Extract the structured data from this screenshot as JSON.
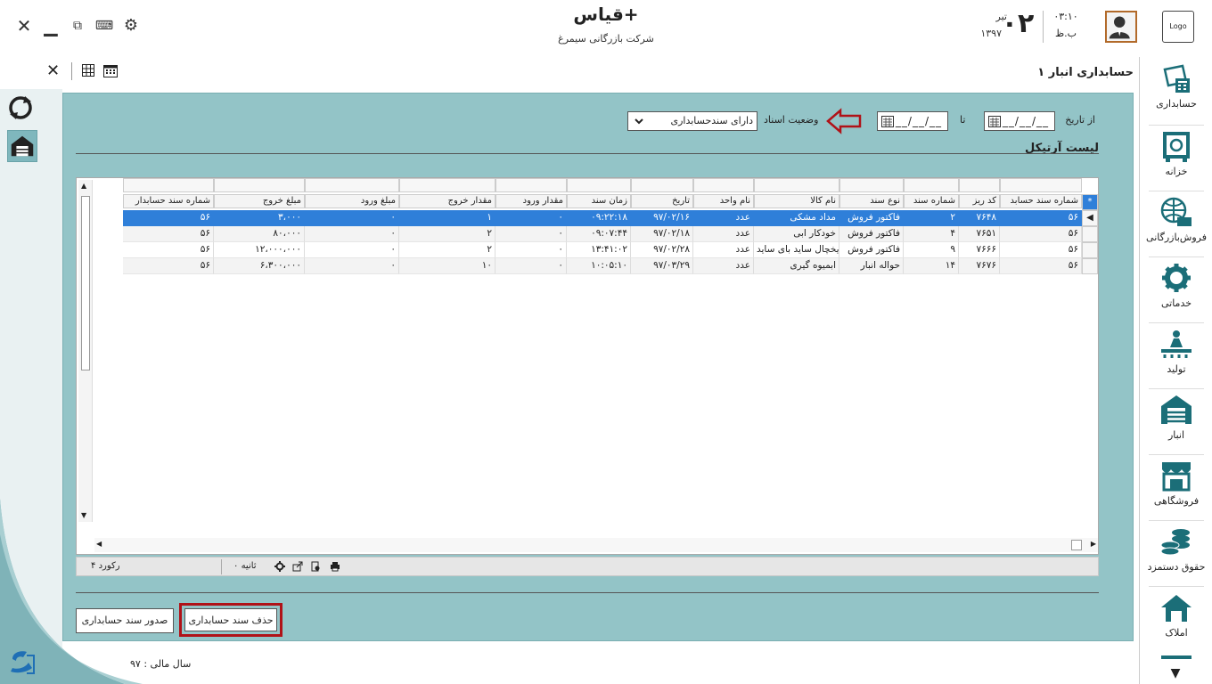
{
  "header": {
    "app_title": "قیاس+",
    "company": "شرکت بازرگانی سیمرغ",
    "time": "۰۳:۱۰",
    "ampm": "ب.ظ",
    "day": "۰۲",
    "month": "تیر",
    "year": "۱۳۹۷",
    "logo_text": "Logo"
  },
  "tab": {
    "page_title": "حسابداری انبار ۱"
  },
  "filters": {
    "from_date_label": "از تاریخ",
    "from_date_value": "__/__/__",
    "to_label": "تا",
    "to_date_value": "__/__/__",
    "status_label": "وضعیت اسناد",
    "status_value": "دارای سندحسابداری"
  },
  "list": {
    "title": "لیست آرتیکل",
    "columns": [
      "شماره سند حسابد",
      "کد ریز",
      "شماره سند",
      "نوع سند",
      "نام کالا",
      "نام واحد",
      "تاریخ",
      "زمان سند",
      "مقدار ورود",
      "مقدار خروج",
      "مبلغ ورود",
      "مبلغ خروج",
      "شماره سند حسابدار"
    ],
    "rows": [
      [
        "۵۶",
        "۷۶۴۸",
        "۲",
        "فاکتور فروش",
        "مداد مشکی",
        "عدد",
        "۹۷/۰۲/۱۶",
        "۰۹:۲۲:۱۸",
        "۰",
        "۱",
        "۰",
        "۳،۰۰۰",
        "۵۶"
      ],
      [
        "۵۶",
        "۷۶۵۱",
        "۴",
        "فاکتور فروش",
        "خودکار ابی",
        "عدد",
        "۹۷/۰۲/۱۸",
        "۰۹:۰۷:۴۴",
        "۰",
        "۲",
        "۰",
        "۸۰،۰۰۰",
        "۵۶"
      ],
      [
        "۵۶",
        "۷۶۶۶",
        "۹",
        "فاکتور فروش",
        "یخچال ساید بای ساید",
        "عدد",
        "۹۷/۰۲/۲۸",
        "۱۳:۴۱:۰۲",
        "۰",
        "۲",
        "۰",
        "۱۲،۰۰۰،۰۰۰",
        "۵۶"
      ],
      [
        "۵۶",
        "۷۶۷۶",
        "۱۴",
        "حواله انبار",
        "ابمیوه گیری",
        "عدد",
        "۹۷/۰۳/۲۹",
        "۱۰:۰۵:۱۰",
        "۰",
        "۱۰",
        "۰",
        "۶،۳۰۰،۰۰۰",
        "۵۶"
      ]
    ],
    "selected_row": 0
  },
  "footer": {
    "records": "۴ رکورد",
    "seconds": "۰ ثانیه"
  },
  "buttons": {
    "delete_doc": "حذف سند حسابداری",
    "issue_doc": "صدور سند حسابداری"
  },
  "fiscal_year": "سال مالی : ۹۷",
  "sidebar": {
    "items": [
      {
        "label": "حسابداری",
        "icon": "calculator-icon"
      },
      {
        "label": "خزانه",
        "icon": "safe-icon"
      },
      {
        "label": "فروش‌بازرگانی",
        "icon": "globe-trade-icon"
      },
      {
        "label": "خدماتی",
        "icon": "gear-icon"
      },
      {
        "label": "تولید",
        "icon": "production-icon"
      },
      {
        "label": "انبار",
        "icon": "warehouse-icon"
      },
      {
        "label": "فروشگاهی",
        "icon": "store-icon"
      },
      {
        "label": "حقوق دستمزد",
        "icon": "coins-icon"
      },
      {
        "label": "املاک",
        "icon": "house-icon"
      }
    ]
  },
  "colors": {
    "panel": "#93c4c7",
    "selected_row": "#2f7fd9",
    "sidebar_icon": "#1b6e78",
    "highlight_border": "#b01218"
  }
}
